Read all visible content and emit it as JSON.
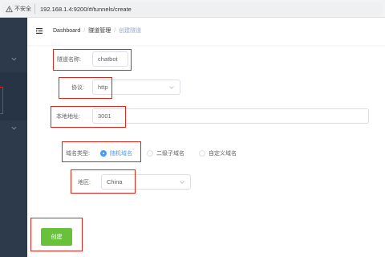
{
  "browser": {
    "security_label": "不安全",
    "url": "192.168.1.4:9200/#/tunnels/create"
  },
  "navbar": {
    "breadcrumb": [
      "Dashboard",
      "隧道管理",
      "创建隧道"
    ],
    "separator": "/"
  },
  "form": {
    "name": {
      "label": "隧道名称:",
      "value": "chatbot"
    },
    "protocol": {
      "label": "协议:",
      "value": "http"
    },
    "local_address": {
      "label": "本地地址:",
      "value": "3001"
    },
    "domain_type": {
      "label": "域名类型:",
      "options": [
        "随机域名",
        "二级子域名",
        "自定义域名"
      ],
      "selected": "随机域名"
    },
    "region": {
      "label": "地区:",
      "value": "China"
    },
    "submit_label": "创建"
  },
  "colors": {
    "sidebar": "#2d3a4b",
    "primary": "#409eff",
    "success": "#67c23a",
    "highlight": "#e1251b"
  },
  "icons": [
    "warning-icon",
    "hamburger-icon",
    "chevron-down-icon",
    "dropdown-arrow-icon"
  ]
}
